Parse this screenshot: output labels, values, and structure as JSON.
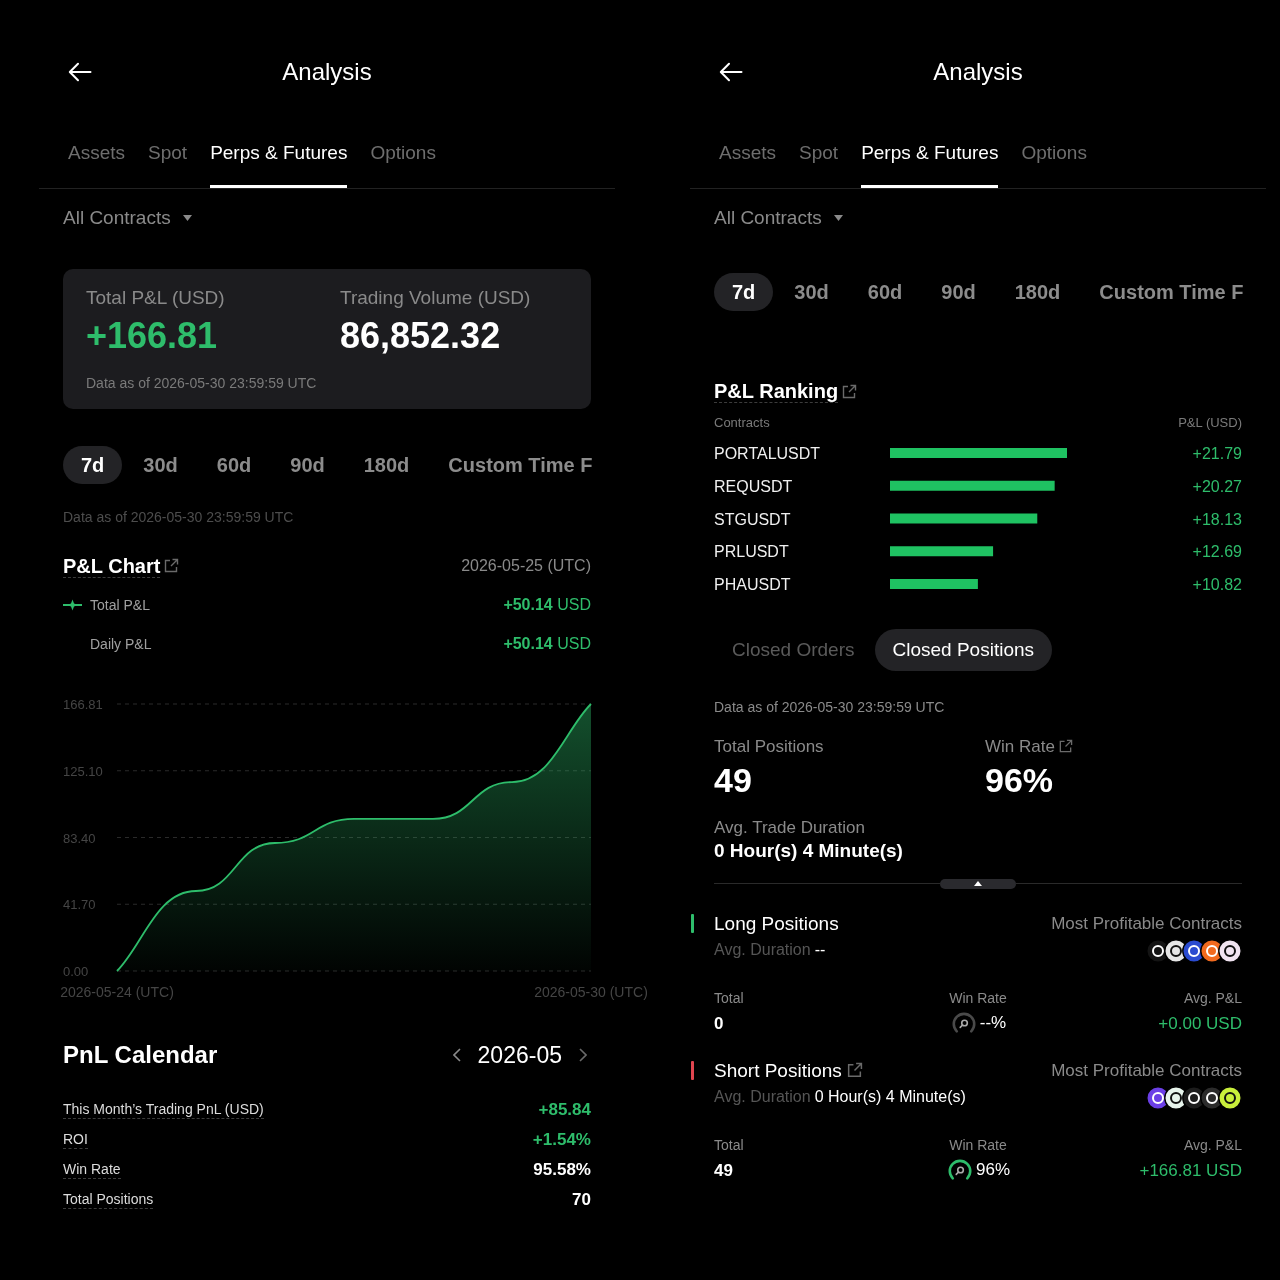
{
  "screens": [
    {
      "title": "Analysis",
      "tabs": [
        {
          "label": "Assets",
          "selected": false
        },
        {
          "label": "Spot",
          "selected": false
        },
        {
          "label": "Perps & Futures",
          "selected": true
        },
        {
          "label": "Options",
          "selected": false
        }
      ],
      "filter": {
        "label": "All Contracts"
      },
      "sections": [
        {
          "kind": "summary",
          "metrics": [
            {
              "label": "Total P&L (USD)",
              "value": "+166.81",
              "positive": true
            },
            {
              "label": "Trading Volume (USD)",
              "value": "86,852.32",
              "positive": false
            }
          ],
          "note": "Data as of 2026-05-30 23:59:59 UTC"
        },
        {
          "kind": "periods",
          "items": [
            {
              "label": "7d",
              "selected": true
            },
            {
              "label": "30d",
              "selected": false
            },
            {
              "label": "60d",
              "selected": false
            },
            {
              "label": "90d",
              "selected": false
            },
            {
              "label": "180d",
              "selected": false
            },
            {
              "label": "Custom Time F",
              "selected": false
            }
          ]
        },
        {
          "kind": "note",
          "text": "Data as of 2026-05-30 23:59:59 UTC"
        },
        {
          "kind": "pnl_chart",
          "title": "P&L Chart",
          "date": "2026-05-25 (UTC)",
          "legend": [
            {
              "label": "Total P&L",
              "value": "**+50.14** USD",
              "marker": true
            },
            {
              "label": "Daily P&L",
              "value": "**+50.14** USD",
              "marker": false
            }
          ],
          "chart_data": {
            "type": "area",
            "categories": [
              "2026-05-24 (UTC)",
              null,
              null,
              null,
              null,
              null,
              "2026-05-30 (UTC)"
            ],
            "series": [
              {
                "color": "#2ebd6b",
                "values": [
                  0,
                  50,
                  80,
                  95,
                  95,
                  118,
                  166.8
                ]
              }
            ],
            "ylim": [
              0,
              166.81
            ],
            "yticks": [
              {
                "value": 0,
                "label": "0.00"
              },
              {
                "value": 41.7,
                "label": "41.70"
              },
              {
                "value": 83.4,
                "label": "83.40"
              },
              {
                "value": 125.1,
                "label": "125.10"
              },
              {
                "value": 166.81,
                "label": "166.81"
              }
            ],
            "grid": true
          }
        },
        {
          "kind": "calendar",
          "title": "PnL Calendar",
          "month": "2026-05",
          "rows": [
            {
              "label": "This Month’s Trading PnL (USD)",
              "value": "+85.84",
              "positive": true
            },
            {
              "label": "ROI",
              "value": "+1.54%",
              "positive": true
            },
            {
              "label": "Win Rate",
              "value": "95.58%",
              "positive": false
            },
            {
              "label": "Total Positions",
              "value": "70",
              "positive": false
            }
          ]
        }
      ]
    },
    {
      "title": "Analysis",
      "tabs": [
        {
          "label": "Assets",
          "selected": false
        },
        {
          "label": "Spot",
          "selected": false
        },
        {
          "label": "Perps & Futures",
          "selected": true
        },
        {
          "label": "Options",
          "selected": false
        }
      ],
      "filter": {
        "label": "All Contracts"
      },
      "sections": [
        {
          "kind": "periods",
          "items": [
            {
              "label": "7d",
              "selected": true
            },
            {
              "label": "30d",
              "selected": false
            },
            {
              "label": "60d",
              "selected": false
            },
            {
              "label": "90d",
              "selected": false
            },
            {
              "label": "180d",
              "selected": false
            },
            {
              "label": "Custom Time F",
              "selected": false
            }
          ]
        },
        {
          "kind": "ranking",
          "title": "P&L Ranking",
          "columns": [
            "Contracts",
            "P&L (USD)"
          ],
          "chart_data": {
            "type": "bar",
            "orientation": "horizontal",
            "categories": [
              "PORTALUSDT",
              "REQUSDT",
              "STGUSDT",
              "PRLUSDT",
              "PHAUSDT"
            ],
            "values": [
              21.79,
              20.27,
              18.13,
              12.69,
              10.82
            ],
            "xlim": [
              0,
              21.79
            ],
            "value_labels": [
              "+21.79",
              "+20.27",
              "+18.13",
              "+12.69",
              "+10.82"
            ]
          }
        },
        {
          "kind": "switch",
          "items": [
            {
              "label": "Closed Orders",
              "selected": false
            },
            {
              "label": "Closed Positions",
              "selected": true
            }
          ]
        },
        {
          "kind": "position_stats",
          "note": "Data as of 2026-05-30 23:59:59 UTC",
          "metrics": [
            {
              "label": "Total Positions",
              "value": "49",
              "link": false
            },
            {
              "label": "Win Rate",
              "value": "96%",
              "link": true
            }
          ],
          "duration": {
            "label": "Avg. Trade Duration",
            "value": "0 Hour(s) 4 Minute(s)"
          }
        },
        {
          "kind": "positions",
          "items": [
            {
              "title": "Long Positions",
              "color": "#2ebd6b",
              "link": false,
              "duration_label": "Avg. Duration",
              "duration": "--",
              "contracts_label": "Most Profitable Contracts",
              "contract_icons": [
                {
                  "color": "#141414"
                },
                {
                  "color": "#e6e6e6"
                },
                {
                  "color": "#2a4bd0"
                },
                {
                  "color": "#f26a1e"
                },
                {
                  "color": "#f1e4f1"
                }
              ],
              "total": {
                "label": "Total",
                "value": "0"
              },
              "win_rate": {
                "label": "Win Rate",
                "value": "--%",
                "color": "#4a4a4a"
              },
              "avg_pnl": {
                "label": "Avg. P&L",
                "value": "+0.00 USD",
                "positive": true
              }
            },
            {
              "title": "Short Positions",
              "color": "#e0454f",
              "link": true,
              "duration_label": "Avg. Duration",
              "duration": "0 Hour(s) 4 Minute(s)",
              "contracts_label": "Most Profitable Contracts",
              "contract_icons": [
                {
                  "color": "#6b3fe6"
                },
                {
                  "color": "#e7f4ec"
                },
                {
                  "color": "#1c1c1c"
                },
                {
                  "color": "#2b2b2b"
                },
                {
                  "color": "#c9ef3b"
                }
              ],
              "total": {
                "label": "Total",
                "value": "49"
              },
              "win_rate": {
                "label": "Win Rate",
                "value": "96%",
                "color": "#2ebd6b"
              },
              "avg_pnl": {
                "label": "Avg. P&L",
                "value": "+166.81 USD",
                "positive": true
              }
            }
          ]
        }
      ]
    }
  ]
}
